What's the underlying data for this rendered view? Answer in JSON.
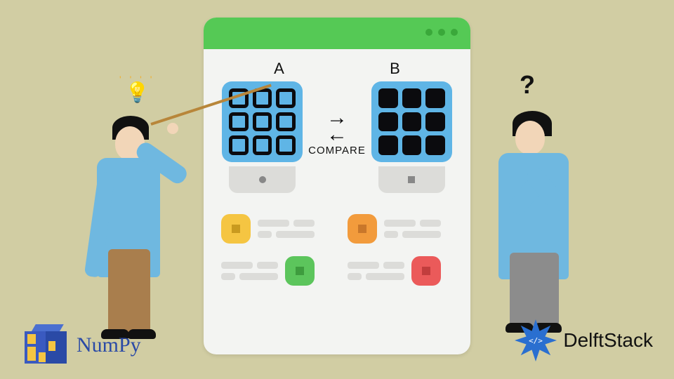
{
  "window": {
    "label_a": "A",
    "label_b": "B",
    "compare": "COMPARE"
  },
  "icons": {
    "bulb": "lightbulb-icon",
    "question": "?"
  },
  "logos": {
    "numpy": "NumPy",
    "delftstack": "DelftStack"
  },
  "badges": {
    "yellow": "yellow",
    "orange": "orange",
    "green": "green",
    "red": "red"
  }
}
